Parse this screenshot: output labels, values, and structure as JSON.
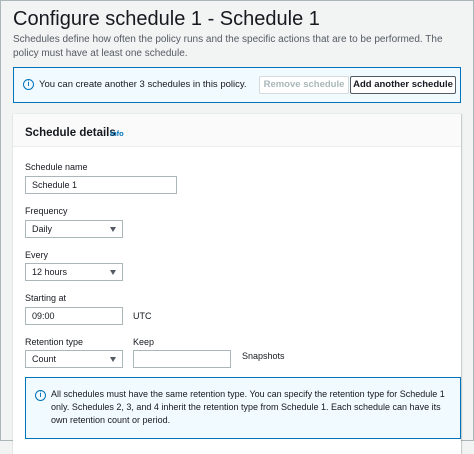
{
  "page": {
    "title": "Configure schedule 1 - Schedule 1",
    "description": "Schedules define how often the policy runs and the specific actions that are to be performed. The policy must have at least one schedule."
  },
  "banner": {
    "icon": "info-icon",
    "text": "You can create another 3 schedules in this policy.",
    "remove_label": "Remove schedule",
    "add_label": "Add another schedule"
  },
  "schedule_details": {
    "title": "Schedule details",
    "info_label": "Info",
    "schedule_name": {
      "label": "Schedule name",
      "value": "Schedule 1"
    },
    "frequency": {
      "label": "Frequency",
      "value": "Daily"
    },
    "every": {
      "label": "Every",
      "value": "12 hours"
    },
    "starting_at": {
      "label": "Starting at",
      "value": "09:00",
      "suffix": "UTC"
    },
    "retention_type": {
      "label": "Retention type",
      "value": "Count"
    },
    "keep": {
      "label": "Keep",
      "value": "",
      "suffix": "Snapshots"
    }
  },
  "note": {
    "icon": "info-icon",
    "text": "All schedules must have the same retention type. You can specify the retention type for Schedule 1 only. Schedules 2, 3, and 4 inherit the retention type from Schedule 1. Each schedule can have its own retention count or period."
  },
  "colors": {
    "accent": "#0073bb",
    "info_background": "#f1faff",
    "page_background": "#f2f3f3"
  }
}
